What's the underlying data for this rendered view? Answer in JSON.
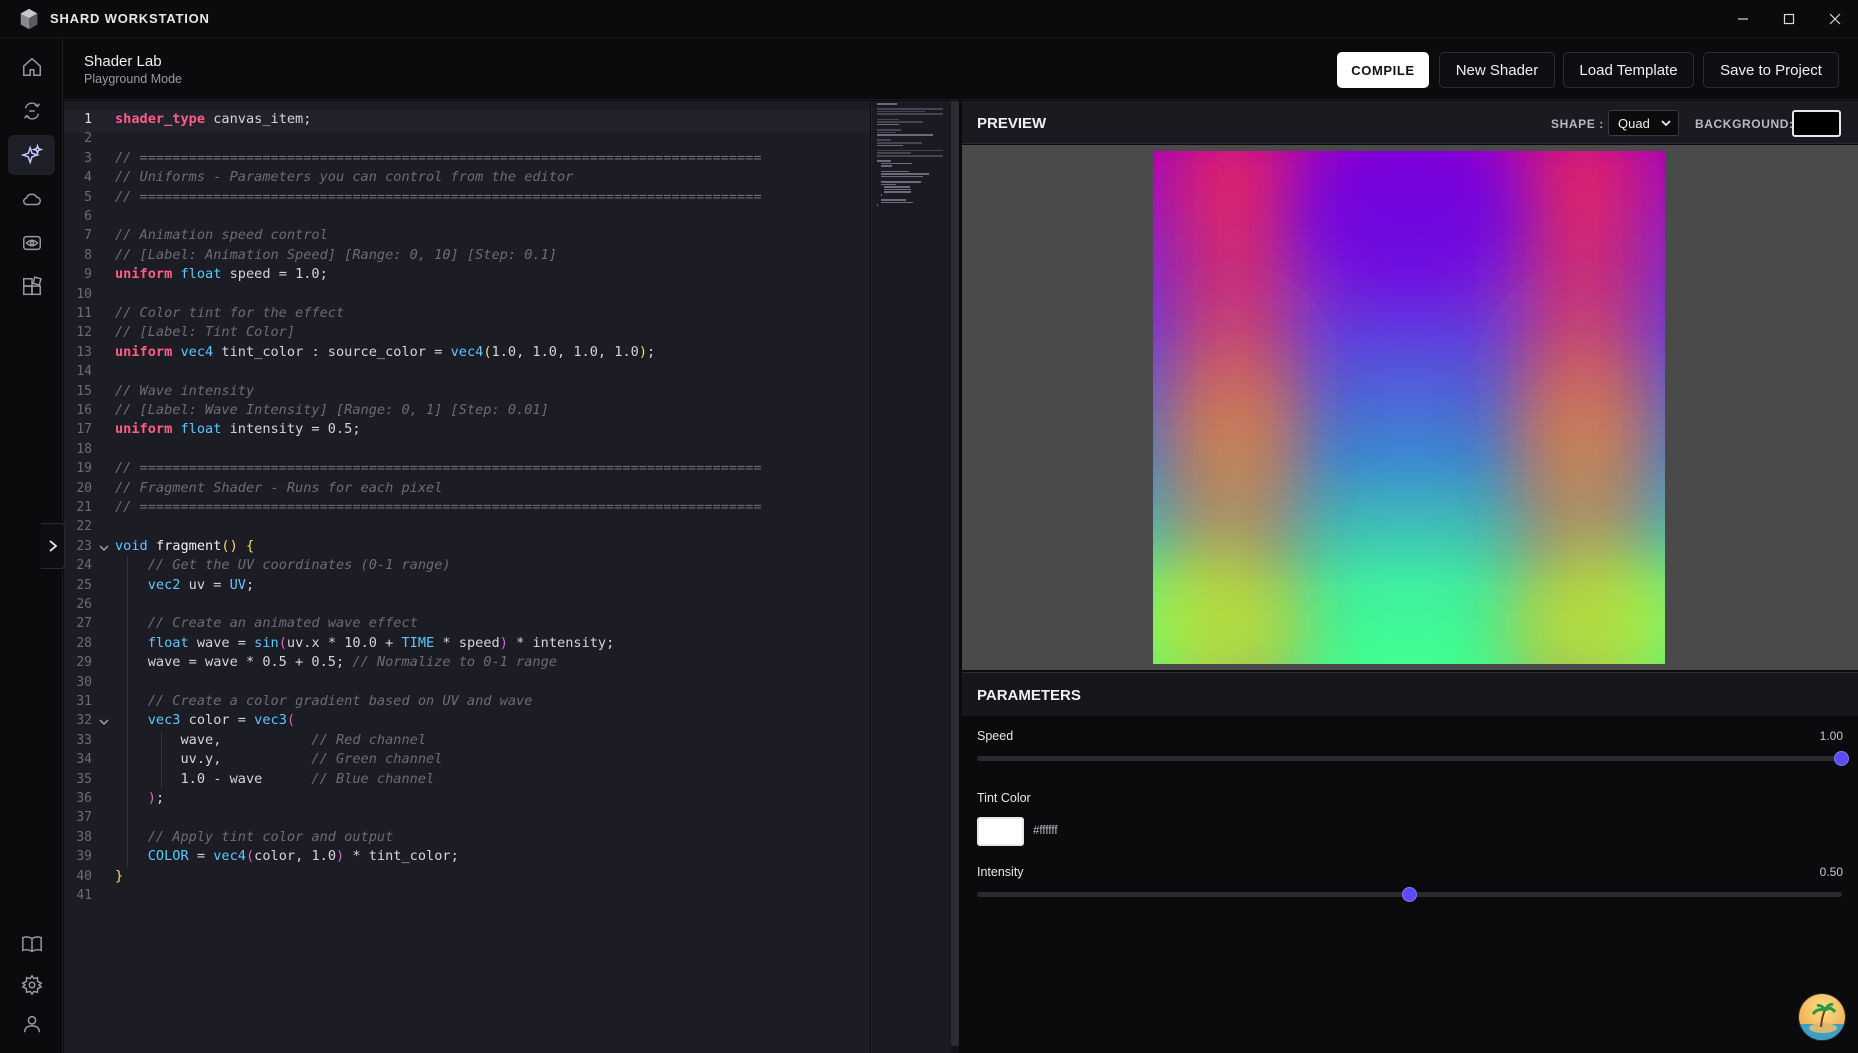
{
  "app": {
    "title": "SHARD WORKSTATION"
  },
  "header": {
    "title": "Shader Lab",
    "subtitle": "Playground Mode",
    "buttons": {
      "compile": "COMPILE",
      "new_shader": "New Shader",
      "load_template": "Load Template",
      "save_to_project": "Save to Project"
    }
  },
  "rail": {
    "items": [
      "home-icon",
      "transform-icon",
      "sparkle-icon",
      "cloud-icon",
      "eye-icon",
      "extensions-icon"
    ],
    "active": "sparkle-icon",
    "bottom_items": [
      "book-icon",
      "gear-icon",
      "user-icon"
    ]
  },
  "editor": {
    "current_line": 1,
    "lines": [
      [
        [
          "kw",
          "shader_type"
        ],
        [
          "t",
          " canvas_item;"
        ]
      ],
      [],
      [
        [
          "cm",
          "// ============================================================================"
        ]
      ],
      [
        [
          "cm",
          "// Uniforms - Parameters you can control from the editor"
        ]
      ],
      [
        [
          "cm",
          "// ============================================================================"
        ]
      ],
      [],
      [
        [
          "cm",
          "// Animation speed control"
        ]
      ],
      [
        [
          "cm",
          "// [Label: Animation Speed] [Range: 0, 10] [Step: 0.1]"
        ]
      ],
      [
        [
          "kw",
          "uniform"
        ],
        [
          "t",
          " "
        ],
        [
          "ty",
          "float"
        ],
        [
          "t",
          " speed = 1.0;"
        ]
      ],
      [],
      [
        [
          "cm",
          "// Color tint for the effect"
        ]
      ],
      [
        [
          "cm",
          "// [Label: Tint Color]"
        ]
      ],
      [
        [
          "kw",
          "uniform"
        ],
        [
          "t",
          " "
        ],
        [
          "ty",
          "vec4"
        ],
        [
          "t",
          " tint_color : source_color = "
        ],
        [
          "ty",
          "vec4"
        ],
        [
          "br",
          "("
        ],
        [
          "t",
          "1.0, 1.0, 1.0, 1.0"
        ],
        [
          "br",
          ")"
        ],
        [
          "t",
          ";"
        ]
      ],
      [],
      [
        [
          "cm",
          "// Wave intensity"
        ]
      ],
      [
        [
          "cm",
          "// [Label: Wave Intensity] [Range: 0, 1] [Step: 0.01]"
        ]
      ],
      [
        [
          "kw",
          "uniform"
        ],
        [
          "t",
          " "
        ],
        [
          "ty",
          "float"
        ],
        [
          "t",
          " intensity = 0.5;"
        ]
      ],
      [],
      [
        [
          "cm",
          "// ============================================================================"
        ]
      ],
      [
        [
          "cm",
          "// Fragment Shader - Runs for each pixel"
        ]
      ],
      [
        [
          "cm",
          "// ============================================================================"
        ]
      ],
      [],
      [
        [
          "ty",
          "void"
        ],
        [
          "t",
          " "
        ],
        [
          "fn",
          "fragment"
        ],
        [
          "br",
          "()"
        ],
        [
          "t",
          " "
        ],
        [
          "br",
          "{"
        ]
      ],
      [
        [
          "t",
          "    "
        ],
        [
          "cm",
          "// Get the UV coordinates (0-1 range)"
        ]
      ],
      [
        [
          "t",
          "    "
        ],
        [
          "ty",
          "vec2"
        ],
        [
          "t",
          " uv = "
        ],
        [
          "ty",
          "UV"
        ],
        [
          "t",
          ";"
        ]
      ],
      [],
      [
        [
          "t",
          "    "
        ],
        [
          "cm",
          "// Create an animated wave effect"
        ]
      ],
      [
        [
          "t",
          "    "
        ],
        [
          "ty",
          "float"
        ],
        [
          "t",
          " wave = "
        ],
        [
          "ty",
          "sin"
        ],
        [
          "br2",
          "("
        ],
        [
          "t",
          "uv.x * 10.0 + "
        ],
        [
          "ty",
          "TIME"
        ],
        [
          "t",
          " * speed"
        ],
        [
          "br2",
          ")"
        ],
        [
          "t",
          " * intensity;"
        ]
      ],
      [
        [
          "t",
          "    wave = wave * 0.5 + 0.5; "
        ],
        [
          "cm",
          "// Normalize to 0-1 range"
        ]
      ],
      [],
      [
        [
          "t",
          "    "
        ],
        [
          "cm",
          "// Create a color gradient based on UV and wave"
        ]
      ],
      [
        [
          "t",
          "    "
        ],
        [
          "ty",
          "vec3"
        ],
        [
          "t",
          " color = "
        ],
        [
          "ty",
          "vec3"
        ],
        [
          "br2",
          "("
        ]
      ],
      [
        [
          "t",
          "        wave,           "
        ],
        [
          "cm",
          "// Red channel"
        ]
      ],
      [
        [
          "t",
          "        uv.y,           "
        ],
        [
          "cm",
          "// Green channel"
        ]
      ],
      [
        [
          "t",
          "        1.0 - wave      "
        ],
        [
          "cm",
          "// Blue channel"
        ]
      ],
      [
        [
          "t",
          "    "
        ],
        [
          "br2",
          ")"
        ],
        [
          "t",
          ";"
        ]
      ],
      [],
      [
        [
          "t",
          "    "
        ],
        [
          "cm",
          "// Apply tint color and output"
        ]
      ],
      [
        [
          "t",
          "    "
        ],
        [
          "ty",
          "COLOR"
        ],
        [
          "t",
          " = "
        ],
        [
          "ty",
          "vec4"
        ],
        [
          "br2",
          "("
        ],
        [
          "t",
          "color, 1.0"
        ],
        [
          "br2",
          ")"
        ],
        [
          "t",
          " * tint_color;"
        ]
      ],
      [
        [
          "br",
          "}"
        ]
      ],
      []
    ],
    "fold_lines": [
      23,
      32
    ]
  },
  "preview": {
    "title": "PREVIEW",
    "shape_label": "SHAPE :",
    "shape_value": "Quad",
    "background_label": "BACKGROUND:",
    "background_color": "#000000"
  },
  "parameters": {
    "title": "PARAMETERS",
    "speed": {
      "label": "Speed",
      "value": "1.00",
      "fraction": 1.0
    },
    "tint": {
      "label": "Tint Color",
      "hex": "#ffffff"
    },
    "intensity": {
      "label": "Intensity",
      "value": "0.50",
      "fraction": 0.5
    }
  },
  "colors": {
    "accent": "#5b4cf5",
    "keyword": "#ff5c8a",
    "type": "#5cc8ff",
    "comment": "#6b6b7a"
  }
}
